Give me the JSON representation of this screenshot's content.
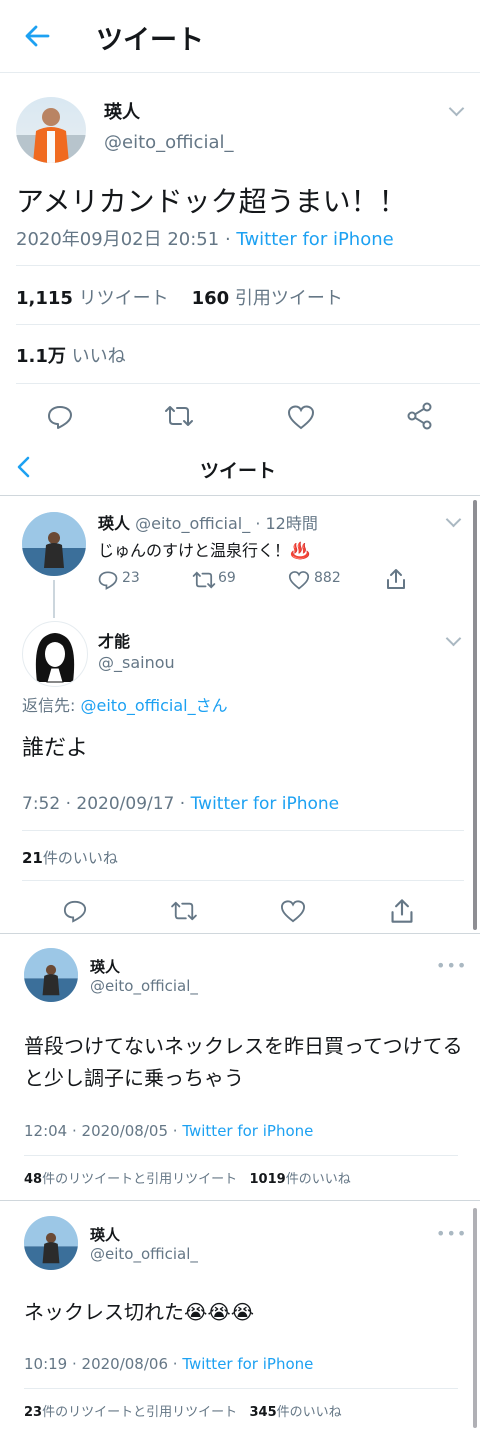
{
  "section1": {
    "header_title": "ツイート",
    "user_name": "瑛人",
    "handle": "@eito_official_",
    "tweet_text": "アメリカンドック超うまい！！",
    "timestamp": "2020年09月02日 20:51",
    "separator": "·",
    "client": "Twitter for iPhone",
    "retweets_count": "1,115",
    "retweets_label": "リツイート",
    "quotes_count": "160",
    "quotes_label": "引用ツイート",
    "likes_count": "1.1万",
    "likes_label": "いいね"
  },
  "section2": {
    "header_title": "ツイート",
    "parent": {
      "user_name": "瑛人",
      "handle": "@eito_official_",
      "time": "· 12時間",
      "text": "じゅんのすけと温泉行く！♨️",
      "reply_count": "23",
      "retweet_count": "69",
      "like_count": "882"
    },
    "reply": {
      "user_name": "才能",
      "handle": "@_sainou",
      "reply_to_label": "返信先:",
      "reply_to_handle": "@eito_official_さん",
      "text": "誰だよ",
      "timestamp": "7:52 · 2020/09/17 ·",
      "client": "Twitter for iPhone",
      "likes_count": "21",
      "likes_label": "件のいいね"
    }
  },
  "section3": {
    "user_name": "瑛人",
    "handle": "@eito_official_",
    "text": "普段つけてないネックレスを昨日買ってつけてると少し調子に乗っちゃう",
    "timestamp": "12:04 · 2020/08/05 ·",
    "client": "Twitter for iPhone",
    "retweets_count": "48",
    "retweets_label": "件のリツイートと引用リツイート",
    "likes_count": "1019",
    "likes_label": "件のいいね"
  },
  "section4": {
    "user_name": "瑛人",
    "handle": "@eito_official_",
    "text": "ネックレス切れた😭😭😭",
    "timestamp": "10:19 · 2020/08/06 ·",
    "client": "Twitter for iPhone",
    "retweets_count": "23",
    "retweets_label": "件のリツイートと引用リツイート",
    "likes_count": "345",
    "likes_label": "件のいいね"
  },
  "colors": {
    "accent": "#1da1f2",
    "text": "#14171a",
    "secondary": "#657786",
    "border": "#e6ecf0"
  },
  "icons": [
    "back-arrow-icon",
    "chevron-down-icon",
    "reply-icon",
    "retweet-icon",
    "like-icon",
    "share-icon",
    "more-icon",
    "hot-springs-icon"
  ]
}
